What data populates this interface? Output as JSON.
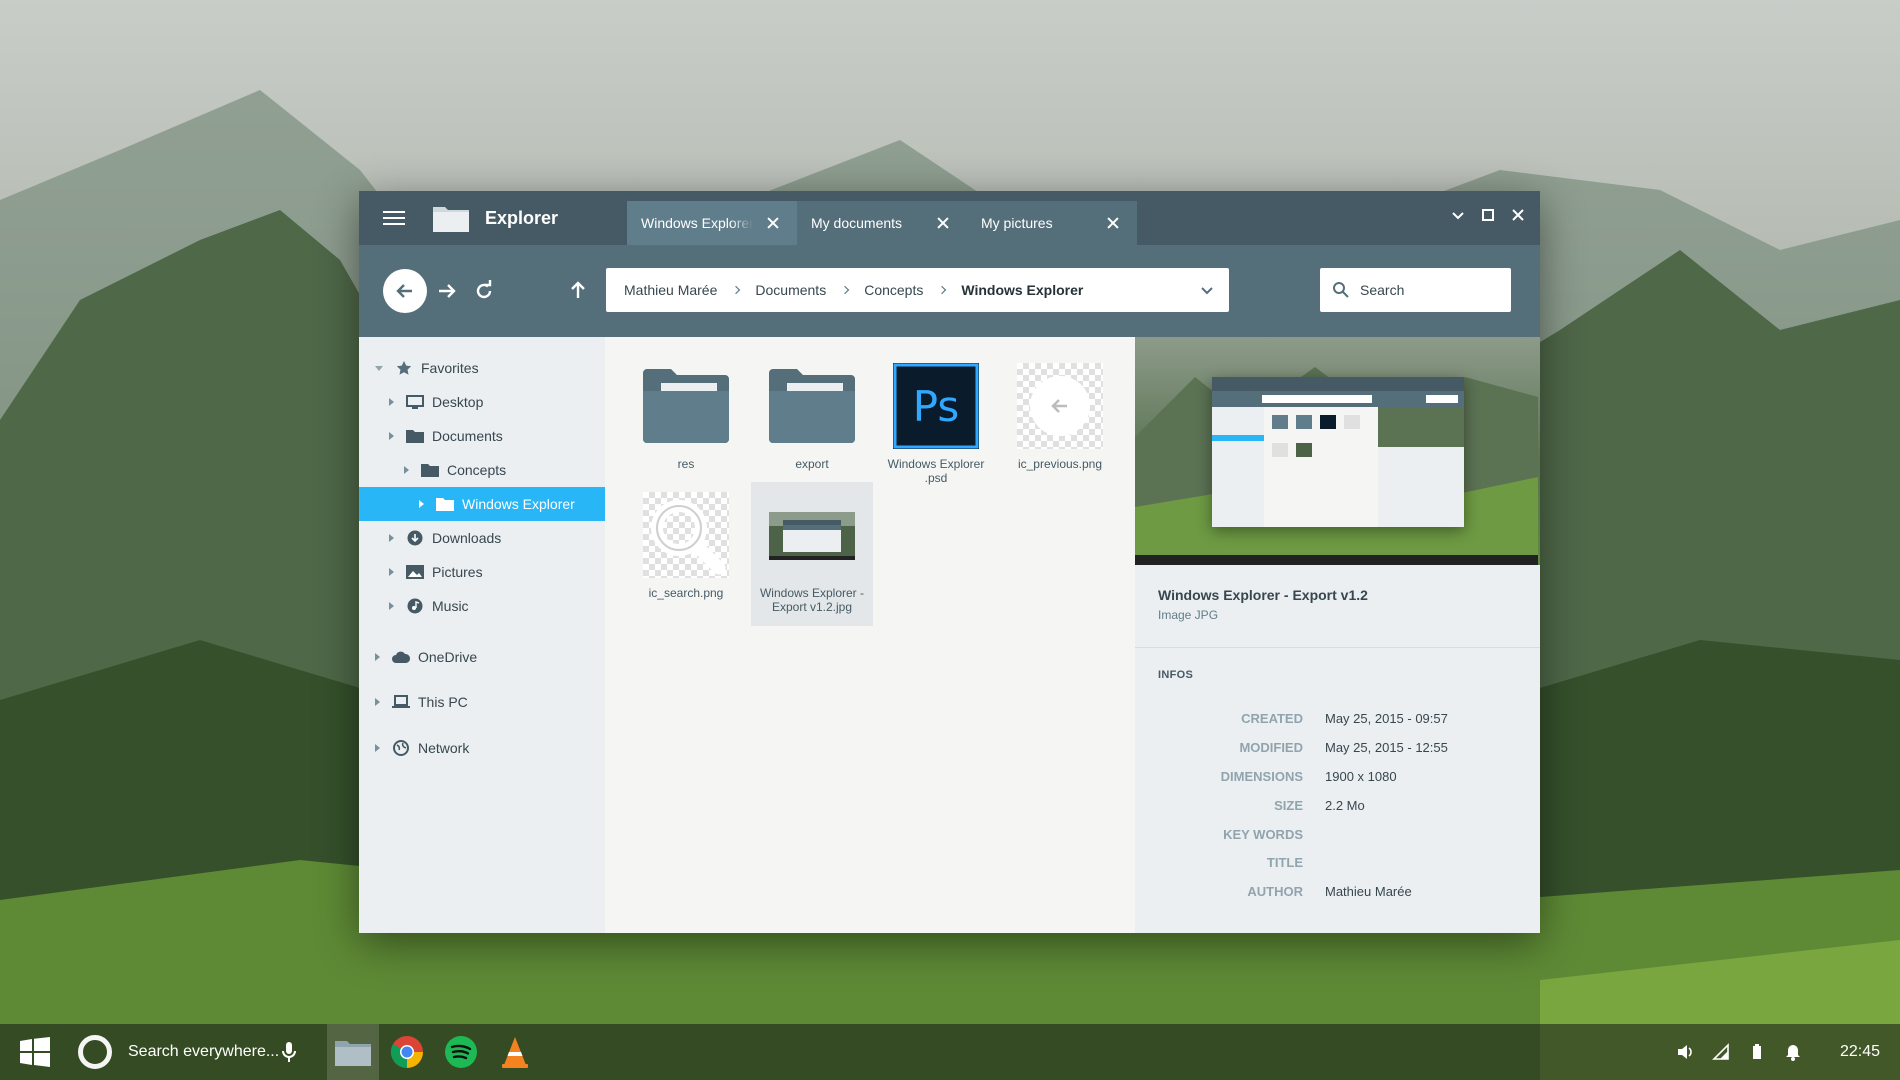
{
  "window": {
    "title": "Explorer",
    "tabs": [
      {
        "label": "Windows Explorer",
        "active": true
      },
      {
        "label": "My documents",
        "active": false
      },
      {
        "label": "My pictures",
        "active": false
      }
    ]
  },
  "toolbar": {
    "breadcrumb": [
      "Mathieu Marée",
      "Documents",
      "Concepts",
      "Windows Explorer"
    ],
    "search_placeholder": "Search"
  },
  "sidebar": {
    "favorites": "Favorites",
    "desktop": "Desktop",
    "documents": "Documents",
    "concepts": "Concepts",
    "windows_explorer": "Windows Explorer",
    "downloads": "Downloads",
    "pictures": "Pictures",
    "music": "Music",
    "onedrive": "OneDrive",
    "this_pc": "This PC",
    "network": "Network"
  },
  "files": [
    {
      "name": "res",
      "type": "folder"
    },
    {
      "name": "export",
      "type": "folder"
    },
    {
      "name": "Windows Explorer .psd",
      "type": "psd"
    },
    {
      "name": "ic_previous.png",
      "type": "png"
    },
    {
      "name": "ic_search.png",
      "type": "png"
    },
    {
      "name": "Windows Explorer - Export v1.2.jpg",
      "type": "jpg",
      "selected": true
    }
  ],
  "preview": {
    "title": "Windows Explorer - Export v1.2",
    "subtitle": "Image JPG",
    "infos_label": "INFOS",
    "info": {
      "created_label": "CREATED",
      "created": "May 25, 2015 - 09:57",
      "modified_label": "MODIFIED",
      "modified": "May 25, 2015 - 12:55",
      "dimensions_label": "DIMENSIONS",
      "dimensions": "1900 x 1080",
      "size_label": "SIZE",
      "size": "2.2 Mo",
      "keywords_label": "KEY WORDS",
      "keywords": "",
      "title_label": "TITLE",
      "title": "",
      "author_label": "AUTHOR",
      "author": "Mathieu Marée"
    }
  },
  "taskbar": {
    "search_placeholder": "Search everywhere...",
    "apps": [
      "explorer-icon",
      "chrome-icon",
      "spotify-icon",
      "vlc-icon"
    ],
    "clock": "22:45"
  },
  "colors": {
    "titlebar": "#455a64",
    "toolbar": "#546e7a",
    "accent": "#29b6f6",
    "folder": "#607d8b"
  }
}
